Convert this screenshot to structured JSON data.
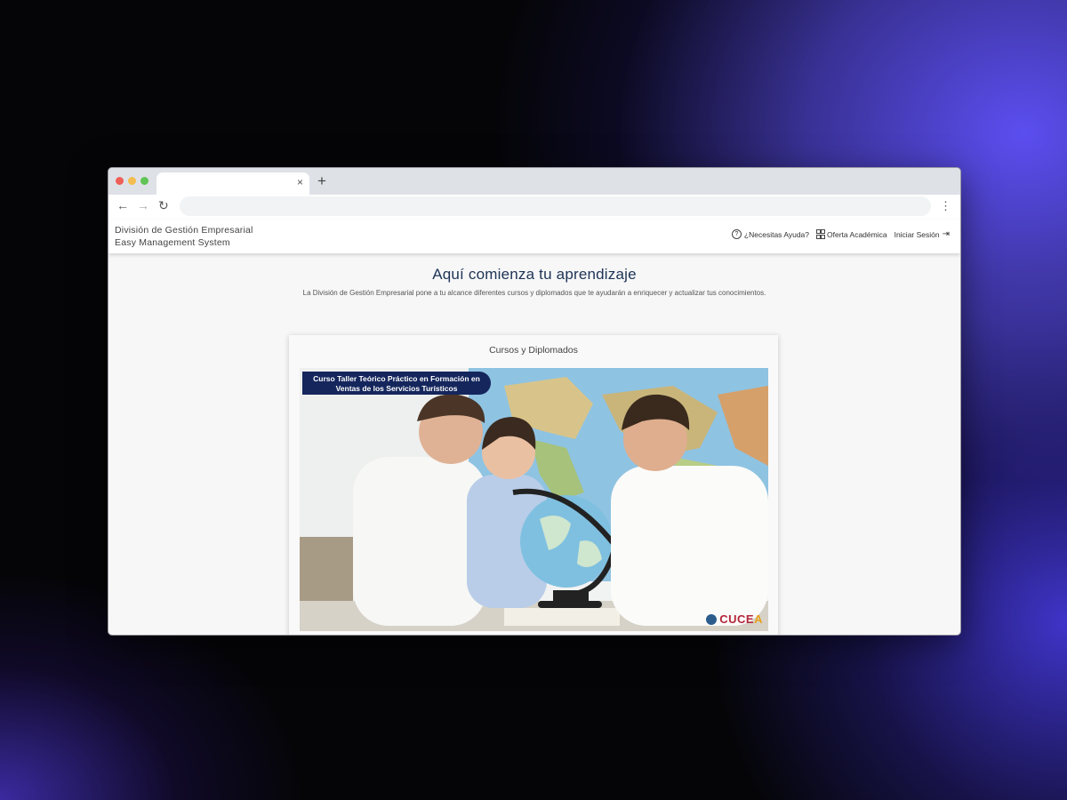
{
  "browser": {
    "new_tab_symbol": "+",
    "tab_close_symbol": "×",
    "back_symbol": "←",
    "forward_symbol": "→",
    "reload_symbol": "↻",
    "menu_symbol": "⋮"
  },
  "header": {
    "brand_line1": "División de Gestión Empresarial",
    "brand_line2": "Easy Management System",
    "help_icon_glyph": "?",
    "help_label": "¿Necesitas Ayuda?",
    "offer_label": "Oferta Académica",
    "login_label": "Iniciar Sesión",
    "login_icon_glyph": "⇥"
  },
  "hero": {
    "title": "Aquí comienza tu aprendizaje",
    "subtitle": "La División de Gestión Empresarial pone a tu alcance diferentes cursos y diplomados que te ayudarán a enriquecer y actualizar tus conocimientos."
  },
  "card": {
    "title": "Cursos y Diplomados",
    "course_badge": "Curso Taller Teórico Práctico en Formación en Ventas de los Servicios Turísticos",
    "logo_text_main": "CUCE",
    "logo_text_accent": "A"
  },
  "colors": {
    "title": "#1d3354",
    "badge_bg": "#14265c",
    "logo_red": "#b4263a",
    "logo_orange": "#e8a21c"
  }
}
